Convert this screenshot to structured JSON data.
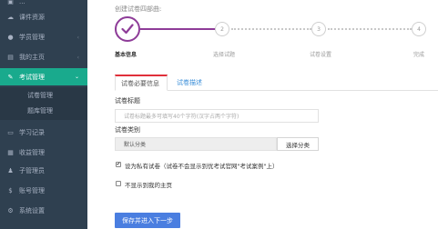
{
  "sidebar": {
    "items": [
      {
        "label": "...",
        "icon": "dashboard-icon"
      },
      {
        "label": "课件资源",
        "icon": "cloud-icon"
      },
      {
        "label": "学员管理",
        "icon": "users-icon"
      },
      {
        "label": "我的主页",
        "icon": "bookmark-icon"
      },
      {
        "label": "考试管理",
        "icon": "exam-icon"
      },
      {
        "label": "学习记录",
        "icon": "doc-icon"
      },
      {
        "label": "收益管理",
        "icon": "wallet-icon"
      },
      {
        "label": "子管理员",
        "icon": "user-icon"
      },
      {
        "label": "账号管理",
        "icon": "dollar-icon"
      },
      {
        "label": "系统设置",
        "icon": "gear-icon"
      }
    ],
    "sub_items": [
      {
        "label": "试卷管理"
      },
      {
        "label": "题库管理"
      }
    ]
  },
  "main": {
    "section_title": "创建试卷四部曲:",
    "steps": [
      {
        "number": "✓",
        "label": "基本信息"
      },
      {
        "number": "2",
        "label": "选择试题"
      },
      {
        "number": "3",
        "label": "试卷设置"
      },
      {
        "number": "4",
        "label": "完成"
      }
    ],
    "tabs": [
      {
        "label": "试卷必要信息"
      },
      {
        "label": "试卷描述"
      }
    ],
    "form": {
      "title_label": "试卷标题",
      "title_placeholder": "试卷标题最多可填写40个字符(汉字占两个字符)",
      "category_label": "试卷类别",
      "category_value": "默认分类",
      "category_button": "选择分类",
      "private_checked": true,
      "private_label": "设为私有试卷（试卷不会显示到优考试官网\"考试案例\"上）",
      "hide_checked": false,
      "hide_label": "不显示到我的主页"
    },
    "submit_label": "保存并进入下一步"
  },
  "colors": {
    "sidebar_bg": "#2f4050",
    "active_green": "#19aa8d",
    "step_purple": "#8e3c98",
    "tab_red": "#e0303a",
    "link_blue": "#3a8ed8",
    "primary_blue": "#4a7ee0"
  }
}
